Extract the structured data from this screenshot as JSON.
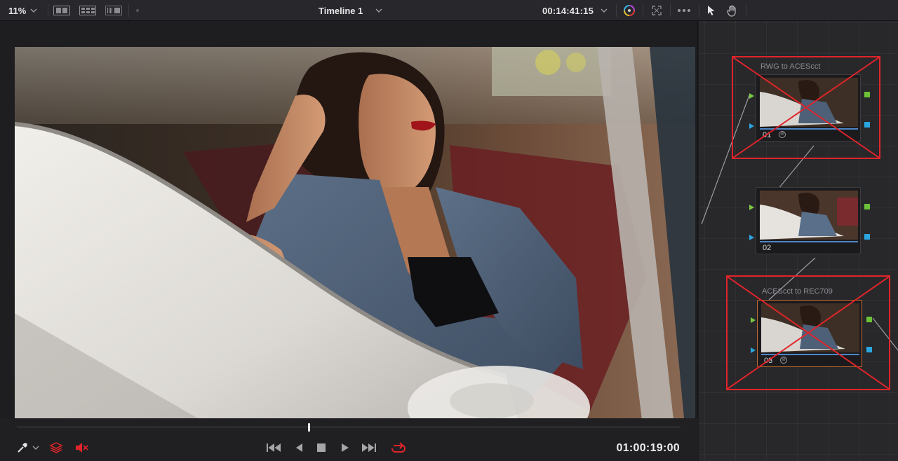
{
  "toolbar": {
    "zoom": "11%",
    "timeline_title": "Timeline 1",
    "timecode": "00:14:41:15"
  },
  "transport": {
    "timecode": "01:00:19:00",
    "playhead_position": 0.44
  },
  "nodes": [
    {
      "number": "01",
      "label": "RWG to ACEScct",
      "crossed_out": true
    },
    {
      "number": "02",
      "label": "",
      "crossed_out": false
    },
    {
      "number": "03",
      "label": "ACEScct to REC709",
      "crossed_out": true,
      "selected": true
    }
  ],
  "colors": {
    "accent_red": "#e0242a",
    "input_port": "#7ac943",
    "output_port_green": "#6cc236",
    "output_port_blue": "#2aa6e0",
    "node_bar": "#4e86c8",
    "selected_border": "#c46a2e"
  },
  "icons": {
    "zoom_dropdown": "chevron-down-icon",
    "viewer_modes": [
      "single-viewer-icon",
      "gallery-viewer-icon",
      "split-viewer-icon"
    ],
    "color_wheel": "color-wheel-icon",
    "fullscreen": "expand-icon",
    "more": "more-icon",
    "pointer": "pointer-icon",
    "hand": "hand-icon",
    "picker": "eyedropper-icon",
    "layers": "layers-icon",
    "mute": "speaker-muted-icon",
    "transport": [
      "skip-back-icon",
      "step-back-icon",
      "stop-icon",
      "play-icon",
      "skip-forward-icon",
      "loop-icon"
    ]
  }
}
